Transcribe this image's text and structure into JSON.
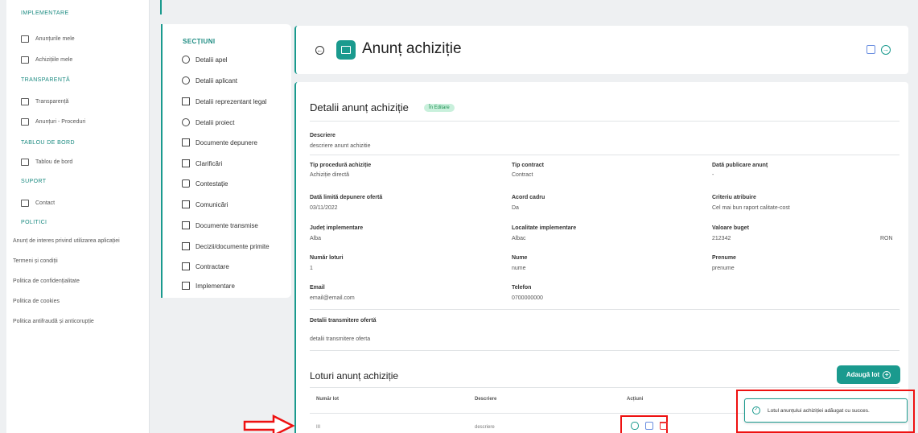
{
  "sidebar": {
    "sections": {
      "implementare": "IMPLEMENTARE",
      "transparenta": "TRANSPARENȚĂ",
      "tablou": "TABLOU DE BORD",
      "suport": "SUPORT",
      "politici": "POLITICI"
    },
    "items": {
      "anunturile_mele": "Anunțurile mele",
      "achizitiile_mele": "Achizițiile mele",
      "transparenta": "Transparență",
      "anunturi_proceduri": "Anunțuri - Proceduri",
      "tablou_de_bord": "Tablou de bord",
      "contact": "Contact"
    },
    "links": [
      "Anunț de interes privind utilizarea aplicației",
      "Termeni și condiții",
      "Politica de confidențialitate",
      "Politica de cookies",
      "Politica antifraudă și anticorupție"
    ]
  },
  "sections_panel": {
    "title": "SECȚIUNI",
    "items": [
      "Detalii apel",
      "Detalii aplicant",
      "Detalii reprezentant legal",
      "Detalii proiect",
      "Documente depunere",
      "Clarificări",
      "Contestație",
      "Comunicări",
      "Documente transmise",
      "Decizii/documente primite",
      "Contractare",
      "Implementare"
    ]
  },
  "header": {
    "title": "Anunț achiziție"
  },
  "details": {
    "title": "Detalii anunț achiziție",
    "status": "În Editare",
    "descriere_label": "Descriere",
    "descriere_value": "descriere anunt achizitie",
    "fields": [
      {
        "label": "Tip procedură achiziție",
        "value": "Achiziție directă"
      },
      {
        "label": "Tip contract",
        "value": "Contract"
      },
      {
        "label": "Dată publicare anunț",
        "value": "-"
      },
      {
        "label": "Dată limită depunere ofertă",
        "value": "03/11/2022"
      },
      {
        "label": "Acord cadru",
        "value": "Da"
      },
      {
        "label": "Criteriu atribuire",
        "value": "Cel mai bun raport calitate-cost"
      },
      {
        "label": "Județ implementare",
        "value": "Alba"
      },
      {
        "label": "Localitate implementare",
        "value": "Albac"
      },
      {
        "label": "Valoare buget",
        "value": "212342"
      },
      {
        "label": "Număr loturi",
        "value": "1"
      },
      {
        "label": "Nume",
        "value": "nume"
      },
      {
        "label": "Prenume",
        "value": "prenume"
      },
      {
        "label": "Email",
        "value": "email@email.com"
      },
      {
        "label": "Telefon",
        "value": "0700000000"
      }
    ],
    "currency": "RON",
    "transmitere_label": "Detalii transmitere ofertă",
    "transmitere_value": "detalii transmitere oferta"
  },
  "loturi": {
    "title": "Loturi anunț achiziție",
    "add_button": "Adaugă lot",
    "columns": [
      "Număr lot",
      "Descriere",
      "Acțiuni"
    ],
    "rows": [
      {
        "numar": "III",
        "descriere": "descriere"
      }
    ]
  },
  "toast": {
    "message": "Lotul anunțului achiziției adăugat cu succes."
  },
  "colors": {
    "accent": "#1a9a8e",
    "highlight": "#e11111"
  }
}
